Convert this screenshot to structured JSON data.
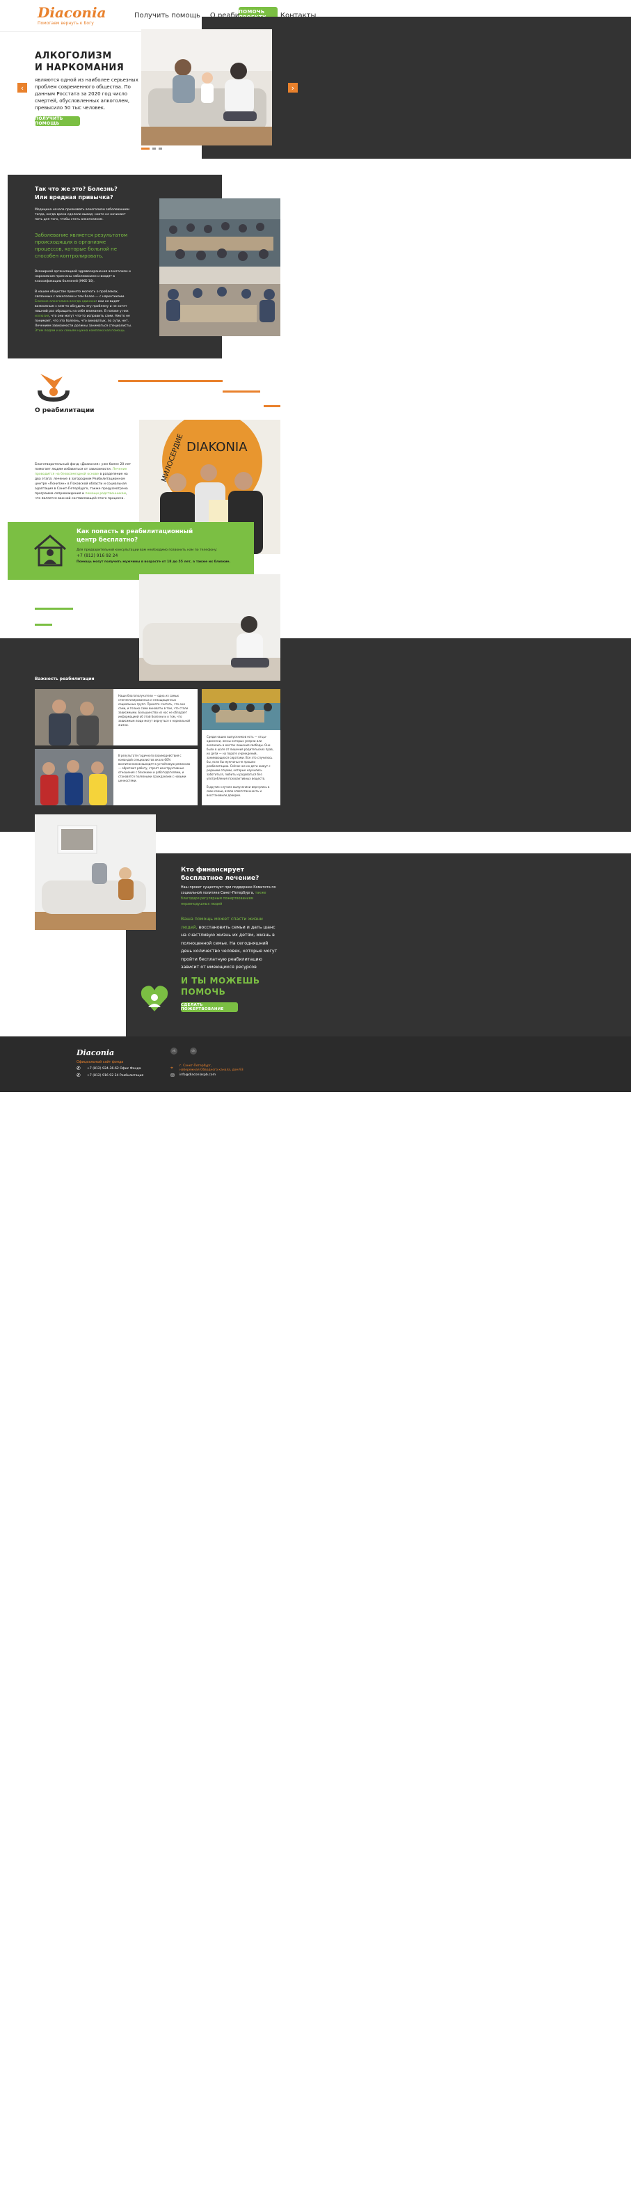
{
  "header": {
    "logo": "Diaconia",
    "logo_sub": "Помогаем вернуть к Богу",
    "nav": [
      "Получить помощь",
      "О реабилитации",
      "Контакты"
    ],
    "cta": "ПОМОЧЬ ПРОЕКТУ"
  },
  "hero": {
    "title_line1": "АЛКОГОЛИЗМ",
    "title_line2": "И НАРКОМАНИЯ",
    "text": "являются одной из наиболее серьезных проблем современного общества. По данным Росстата за 2020 год число смертей, обусловленных алкоголем, превысило 50 тыс человек.",
    "button": "ПОЛУЧИТЬ ПОМОЩЬ",
    "prev_icon": "chevron-left-icon",
    "next_icon": "chevron-right-icon"
  },
  "disease": {
    "title_line1": "Так что же это? Болезнь?",
    "title_line2": "Или вредная привычка?",
    "p1": "Медицина начала признавать алкоголизм заболеванием тогда, когда врачи сделали вывод: никто не начинает пить для того, чтобы стать алкоголиком.",
    "p2": "Заболевание является результатом происходящих в организме процессов, которые больной не способен контролировать.",
    "p3": "Всемирной организацией здравоохранения алкоголизм и наркомания признаны заболеванием и входят в классификацию болезней (МКБ-10).",
    "p4a": "В нашем обществе принято молчать о проблемах, связанных с алкоголем и тем более — с наркотиками. ",
    "p4b": "Близкие алкоголика всегда одиноки",
    "p4c": ": они не видят возможным с кем-то обсудить эту проблему и не хотят лишний раз обращать на себя внимание. В голове у них ",
    "p4d": "иллюзия",
    "p4e": ", что они могут что-то исправить сами. Никто не понимает, что это болезнь, что виноватых, по сути, нет. Лечением зависимости должны заниматься специалисты. ",
    "p4f": "Этим людям и их семьям нужна комплексная помощь."
  },
  "about": {
    "title": "О реабилитации",
    "p_a": "Благотворительный фонд «Диакония» уже более 20 лет помогает людям избавиться от зависимости. ",
    "p_b": "Лечение проводится на безвозмездной основе",
    "p_c": " в разделение на два этапа: лечение в загородном Реабилитационном центре «Понитин» в Псковской области и социальная адаптация в Санкт-Петербурге, также предусмотрена программа сопровождения и ",
    "p_d": "помощи родственникам",
    "p_e": ", что является важной составляющей этого процесса.",
    "sign_word": "DIAKONIA",
    "sign_word2": "МИЛОСЕРДИЕ"
  },
  "free": {
    "title_line1": "Как попасть в реабилитационный",
    "title_line2": "центр бесплатно?",
    "text": "Для предварительной консультации вам необходимо позвонить нам по телефону:",
    "phone": "+7 (812) 916 92 24",
    "note": "Помощь могут получить мужчины в возрасте от 18 до 55 лет, а также их близкие."
  },
  "importance": {
    "title": "Важность реабилитации",
    "card1": "Наши благополучатели — одна из самых стигматизированных и незащищенных социальных групп. Принято считать, что они сами, и только сами виноваты в том, что стали зависимыми. Большинство из нас не обладает информацией об этой болезни и о том, что зависимым люди могут вернуться к нормальной жизни.",
    "card2": "В результате годичного взаимодействия с командой специалистов около 60% воспитанников выходят в устойчивую ремиссию — обретают работу, строят конструктивные отношения с близкими и работодателями, и становятся полезными гражданами с новыми ценностями.",
    "card3": "Среди наших выпускников есть — отцы-одиночки, жены которых умерли или оказались в местах лишения свободы. Они были в шаге от лишения родительских прав, их дети — на пороге учреждений, занимающихся сиротами. Все это случилось бы, если бы мужчины не прошли реабилитацию. Сейчас же их дети живут с родными отцами, которые научились заботиться, любить и радоваться без употребления психоактивных веществ.",
    "card4": "В других случаях выпускники вернулись в свои семьи, взяли ответственность и восстановили доверие."
  },
  "finance": {
    "title_line1": "Кто финансирует",
    "title_line2": "бесплатное лечение?",
    "text_a": "Наш проект существует при поддержке Комитета по социальной политике Санкт-Петербурга, ",
    "text_b": "также благодаря регулярным пожертвованиям неравнодушных людей",
    "quote_green": "Ваша помощь может спасти жизни людей,",
    "quote_rest": "восстановить семьи и дать шанс на счастливую жизнь их детям, жизнь в полноценной семье. На сегодняшний день количество человек, которые могут пройти бесплатную реабилитацию зависит от имеющихся ресурсов",
    "help_line1": "И ТЫ МОЖЕШЬ",
    "help_line2": "ПОМОЧЬ",
    "button": "СДЕЛАТЬ ПОЖЕРТВОВАНИЕ"
  },
  "footer": {
    "logo": "Diaconia",
    "site": "Официальный сайт фонда",
    "phone1": "+7 (812) 924-36-62 Офис Фонда",
    "phone2": "+7 (812) 916 92 24 Реабилитация",
    "address_line1": "г. Санкт-Петербург,",
    "address_line2": "набережная Обводного канала, дом 93",
    "email": "info@diaconiaspb.com",
    "social": [
      "vk-icon",
      "ok-icon"
    ]
  },
  "colors": {
    "accent_green": "#7bbf43",
    "accent_orange": "#e9812c",
    "dark": "#333333"
  }
}
